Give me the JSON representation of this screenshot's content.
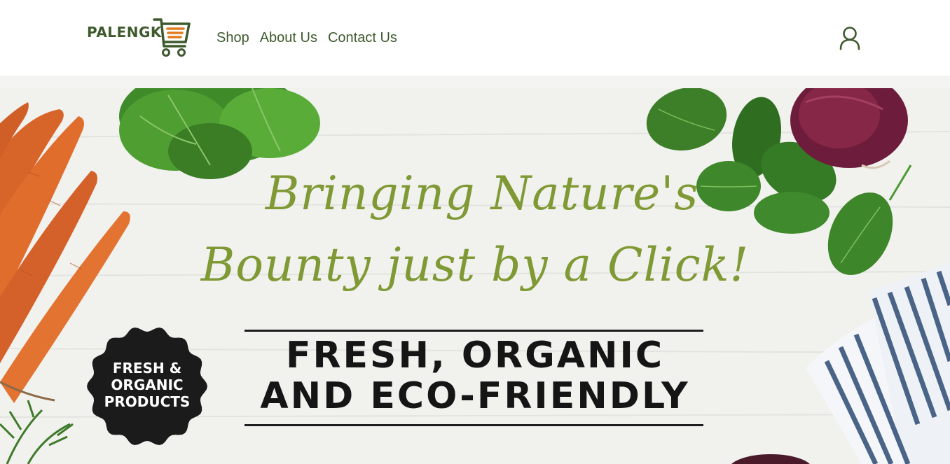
{
  "brand": {
    "name": "PALENGK",
    "icon": "cart-icon"
  },
  "nav": {
    "items": [
      {
        "label": "Shop"
      },
      {
        "label": "About Us"
      },
      {
        "label": "Contact Us"
      }
    ]
  },
  "header": {
    "account_icon": "user-icon"
  },
  "hero": {
    "script_line_1": "Bringing Nature's",
    "script_line_2": "Bounty just by a Click!",
    "tagline_line_1": "FRESH, ORGANIC",
    "tagline_line_2": "AND ECO-FRIENDLY",
    "badge_lines": [
      "FRESH &",
      "ORGANIC",
      "PRODUCTS"
    ]
  },
  "colors": {
    "brand_green": "#3e5a2c",
    "accent_orange": "#e07b1f",
    "script_green": "#7f9a35",
    "badge_black": "#1b1b1b"
  }
}
